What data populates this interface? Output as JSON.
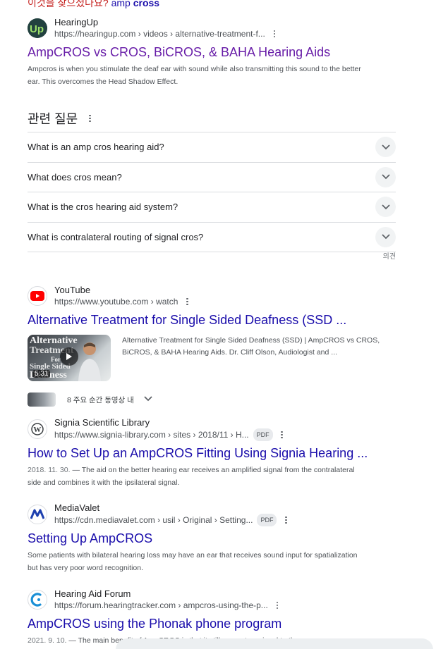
{
  "top_partial": {
    "prefix": "이것을 찾으셨나요?",
    "q1": "amp",
    "q2": "cross"
  },
  "results": [
    {
      "source": "HearingUp",
      "url": "https://hearingup.com › videos › alternative-treatment-f...",
      "title": "AmpCROS vs CROS, BiCROS, & BAHA Hearing Aids",
      "snippet": "Ampcros is when you stimulate the deaf ear with sound while also transmitting this sound to the better ear. This overcomes the Head Shadow Effect.",
      "favicon": "hearingup-icon"
    },
    {
      "source": "YouTube",
      "url": "https://www.youtube.com › watch",
      "title": "Alternative Treatment for Single Sided Deafness (SSD ...",
      "video_desc": "Alternative Treatment for Single Sided Deafness (SSD) | AmpCROS vs CROS, BiCROS, & BAHA Hearing Aids. Dr. Cliff Olson, Audiologist and ...",
      "duration": "5:31",
      "moments": "8 주요 순간 동영상 내",
      "thumb_text": [
        "Alternative",
        "Treatment",
        "For",
        "Single Sided",
        "Deafness"
      ],
      "favicon": "youtube-icon"
    },
    {
      "source": "Signia Scientific Library",
      "url": "https://www.signia-library.com › sites › 2018/11 › H...",
      "badge": "PDF",
      "title": "How to Set Up an AmpCROS Fitting Using Signia Hearing ...",
      "date": "2018. 11. 30.",
      "snippet": "The aid on the better hearing ear receives an amplified signal from the contralateral side and combines it with the ipsilateral signal.",
      "favicon": "wordpress-icon"
    },
    {
      "source": "MediaValet",
      "url": "https://cdn.mediavalet.com › usil › Original › Setting...",
      "badge": "PDF",
      "title": "Setting Up AmpCROS",
      "snippet": "Some patients with bilateral hearing loss may have an ear that receives sound input for spatialization but has very poor word recognition.",
      "favicon": "mediavalet-icon"
    },
    {
      "source": "Hearing Aid Forum",
      "url": "https://forum.hearingtracker.com › ampcros-using-the-p...",
      "title": "AmpCROS using the Phonak phone program",
      "date": "2021. 9. 10.",
      "snippet": "The main benefit of AmpCROS is that it still presents a signal to the poorer ear.",
      "favicon": "hearingtracker-icon"
    }
  ],
  "paa": {
    "heading": "관련 질문",
    "questions": [
      "What is an amp cros hearing aid?",
      "What does cros mean?",
      "What is the cros hearing aid system?",
      "What is contralateral routing of signal cros?"
    ],
    "feedback": "의견"
  },
  "colors": {
    "link": "#1a0dab",
    "visited": "#681da8",
    "text": "#202124",
    "muted": "#4d5156"
  }
}
